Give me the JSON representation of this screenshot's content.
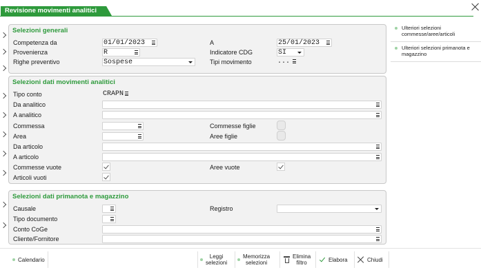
{
  "window": {
    "title": "Revisione movimenti analitici"
  },
  "selezioni_generali": {
    "title": "Selezioni generali",
    "competenza_da": {
      "label": "Competenza da",
      "value": "01/01/2023"
    },
    "a": {
      "label": "A",
      "value": "25/01/2023"
    },
    "provenienza": {
      "label": "Provenienza",
      "value": "R"
    },
    "indicatore_cdg": {
      "label": "Indicatore CDG",
      "value": "SI"
    },
    "righe_preventivo": {
      "label": "Righe preventivo",
      "value": "Sospese"
    },
    "tipi_movimento": {
      "label": "Tipi movimento",
      "value": "..."
    }
  },
  "selezioni_analitici": {
    "title": "Selezioni dati movimenti analitici",
    "tipo_conto": {
      "label": "Tipo conto",
      "value": "CRAPN"
    },
    "da_analitico": {
      "label": "Da analitico",
      "value": ""
    },
    "a_analitico": {
      "label": "A analitico",
      "value": ""
    },
    "commessa": {
      "label": "Commessa",
      "value": ""
    },
    "commesse_figlie": {
      "label": "Commesse figlie"
    },
    "area": {
      "label": "Area",
      "value": ""
    },
    "aree_figlie": {
      "label": "Aree figlie"
    },
    "da_articolo": {
      "label": "Da articolo",
      "value": ""
    },
    "a_articolo": {
      "label": "A articolo",
      "value": ""
    },
    "commesse_vuote": {
      "label": "Commesse vuote",
      "checked": true
    },
    "aree_vuote": {
      "label": "Aree vuote",
      "checked": true
    },
    "articoli_vuoti": {
      "label": "Articoli vuoti",
      "checked": true
    }
  },
  "selezioni_primanota": {
    "title": "Selezioni dati primanota e magazzino",
    "causale": {
      "label": "Causale",
      "value": ""
    },
    "registro": {
      "label": "Registro",
      "value": ""
    },
    "tipo_documento": {
      "label": "Tipo documento",
      "value": ""
    },
    "conto_coge": {
      "label": "Conto CoGe",
      "value": ""
    },
    "cliente_fornitore": {
      "label": "Cliente/Fornitore",
      "value": ""
    }
  },
  "side_panel": {
    "items": [
      {
        "label": "Ulteriori selezioni commesse/aree/articoli"
      },
      {
        "label": "Ulteriori selezioni primanota e magazzino"
      }
    ]
  },
  "bottom_bar": {
    "calendario": "Calendario",
    "leggi_1": "Leggi",
    "leggi_2": "selezioni",
    "memorizza_1": "Memorizza",
    "memorizza_2": "selezioni",
    "elimina_1": "Elimina",
    "elimina_2": "filtro",
    "elabora": "Elabora",
    "chiudi": "Chiudi"
  },
  "colors": {
    "accent": "#2e9a3c",
    "panel_bg": "#f2f2f2",
    "field_bg": "#ffffff"
  },
  "icons": [
    "close-icon",
    "chevron-right-icon",
    "picker-icon",
    "dropdown-icon",
    "check-icon",
    "trash-icon",
    "close-icon"
  ]
}
